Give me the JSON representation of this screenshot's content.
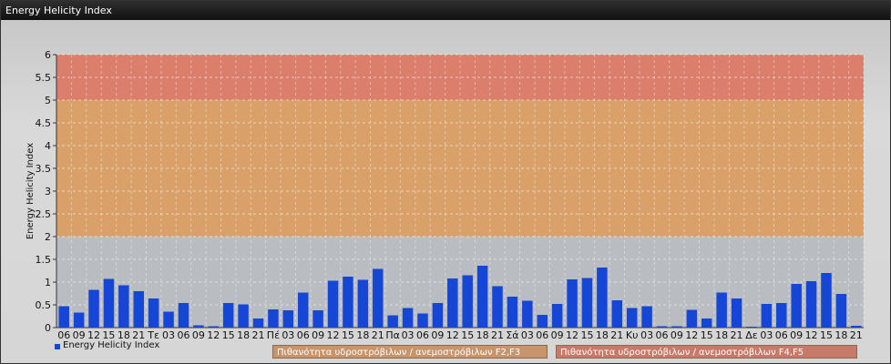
{
  "window": {
    "title": "Energy Helicity Index"
  },
  "legend": {
    "series_label": "Energy Helicity Index"
  },
  "risk_labels": [
    {
      "text": "Πιθανότητα υδροστρόβιλων / ανεμοστρόβιλων F2,F3",
      "color": "#c8946c"
    },
    {
      "text": "Πιθανότητα υδροστρόβιλων / ανεμοστρόβιλων F4,F5",
      "color": "#c87a6a"
    }
  ],
  "colors": {
    "bar": "#1646d6",
    "band_low": "#b9bcc0",
    "band_mid": "#d9a06a",
    "band_high": "#db7f6c"
  },
  "chart_data": {
    "type": "bar",
    "title": "",
    "xlabel": "",
    "ylabel": "Energy Helicity Index",
    "ylim": [
      0,
      6
    ],
    "yticks": [
      "0",
      "0.5",
      "1",
      "1.5",
      "2",
      "2.5",
      "3",
      "3.5",
      "4",
      "4.5",
      "5",
      "5.5",
      "6"
    ],
    "grid": true,
    "bands": [
      {
        "from": 0,
        "to": 2
      },
      {
        "from": 2,
        "to": 5
      },
      {
        "from": 5,
        "to": 6
      }
    ],
    "categories": [
      "06",
      "09",
      "12",
      "15",
      "18",
      "21",
      "Τε",
      "03",
      "06",
      "09",
      "12",
      "15",
      "18",
      "21",
      "Πέ",
      "03",
      "06",
      "09",
      "12",
      "15",
      "18",
      "21",
      "Πα",
      "03",
      "06",
      "09",
      "12",
      "15",
      "18",
      "21",
      "Σά",
      "03",
      "06",
      "09",
      "12",
      "15",
      "18",
      "21",
      "Κυ",
      "03",
      "06",
      "09",
      "12",
      "15",
      "18",
      "21",
      "Δε",
      "03",
      "06",
      "09",
      "12",
      "15",
      "18",
      "21"
    ],
    "series": [
      {
        "name": "Energy Helicity Index",
        "values": [
          0.47,
          0.33,
          0.83,
          1.07,
          0.93,
          0.8,
          0.64,
          0.35,
          0.54,
          0.05,
          0.03,
          0.54,
          0.51,
          0.2,
          0.4,
          0.38,
          0.77,
          0.38,
          1.03,
          1.12,
          1.05,
          1.29,
          0.27,
          0.43,
          0.31,
          0.54,
          1.08,
          1.15,
          1.36,
          0.91,
          0.68,
          0.59,
          0.28,
          0.52,
          1.06,
          1.09,
          1.32,
          0.6,
          0.43,
          0.47,
          0.03,
          0.03,
          0.39,
          0.2,
          0.77,
          0.64,
          0.02,
          0.52,
          0.54,
          0.96,
          1.02,
          1.2,
          0.74,
          0.04
        ]
      }
    ]
  }
}
